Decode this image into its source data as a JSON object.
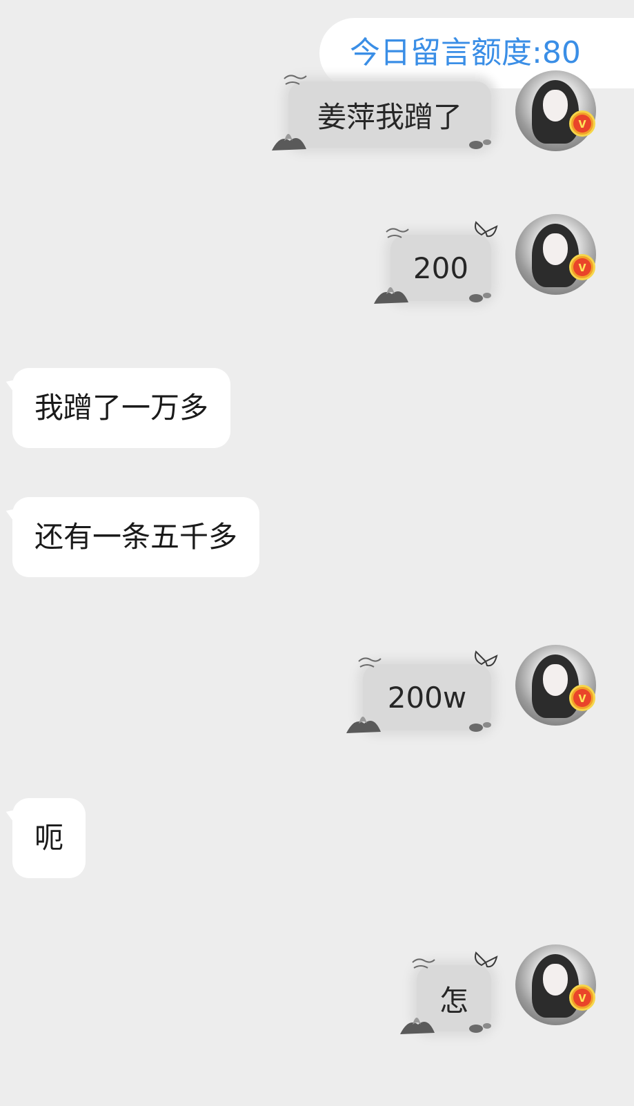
{
  "quota": {
    "label": "今日留言额度:80"
  },
  "messages": [
    {
      "direction": "out",
      "text": "姜萍我蹭了"
    },
    {
      "direction": "out",
      "text": "200"
    },
    {
      "direction": "in",
      "text": "我蹭了一万多"
    },
    {
      "direction": "in",
      "text": "还有一条五千多"
    },
    {
      "direction": "out",
      "text": "200w"
    },
    {
      "direction": "in",
      "text": "呃"
    },
    {
      "direction": "out",
      "text": "怎"
    }
  ],
  "avatar": {
    "badge_letter": "v"
  },
  "colors": {
    "background": "#ededed",
    "quota_text": "#3a8ee6",
    "incoming_bubble": "#ffffff",
    "outgoing_bubble": "#d9d9d9",
    "badge": "#e9442a"
  }
}
